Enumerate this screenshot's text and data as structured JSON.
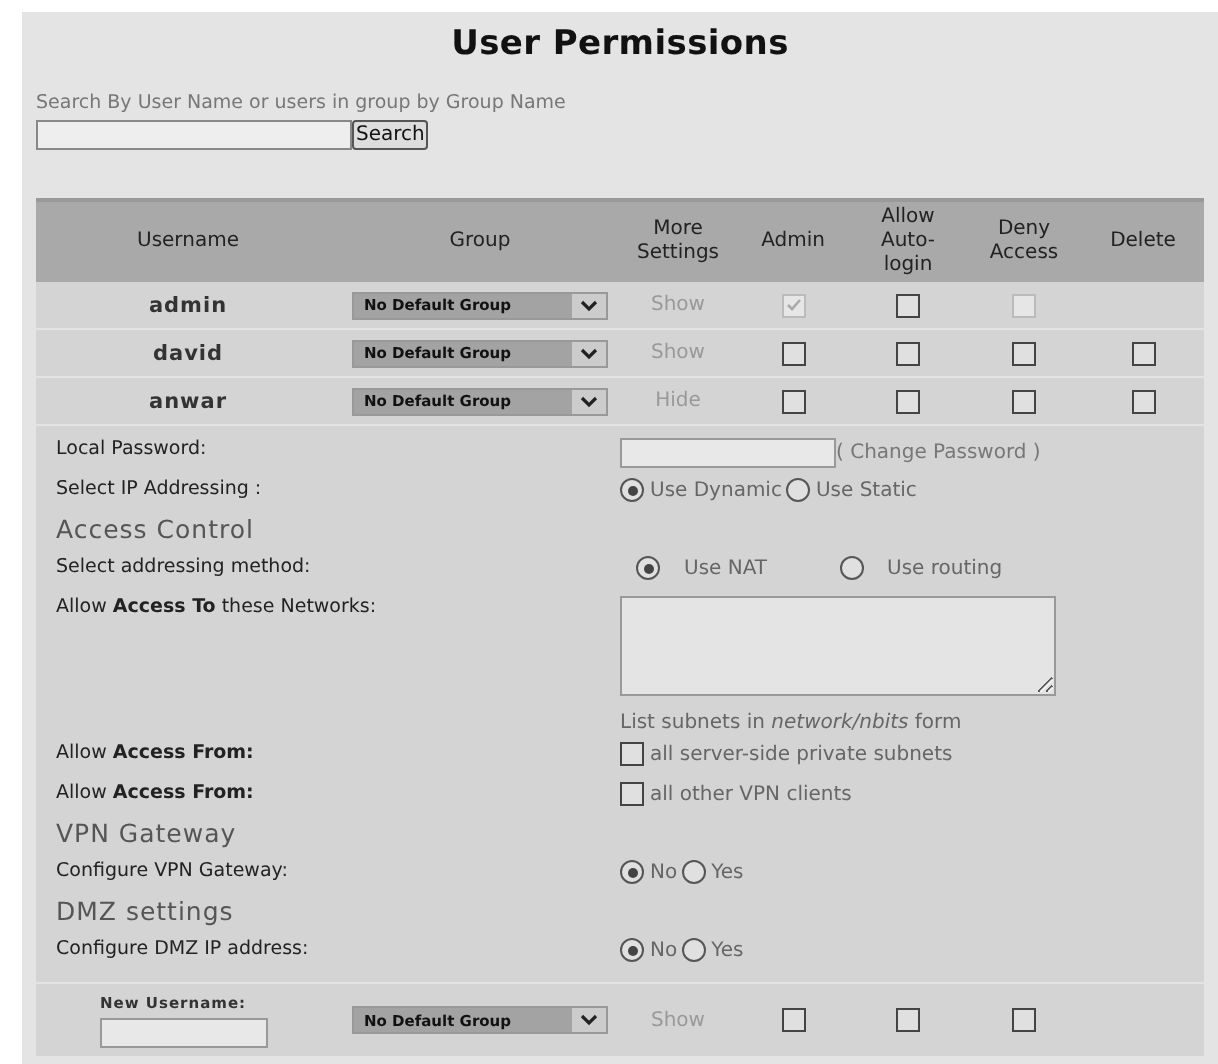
{
  "title": "User Permissions",
  "search": {
    "label": "Search By User Name or users in group by Group Name",
    "button": "Search"
  },
  "table": {
    "columns": [
      "Username",
      "Group",
      "More Settings",
      "Admin",
      "Allow Auto-login",
      "Deny Access",
      "Delete"
    ],
    "rows": [
      {
        "username": "admin",
        "group": "No Default Group",
        "more": "Show",
        "checks": [
          {
            "checked": true,
            "disabled": true
          },
          {
            "checked": false,
            "disabled": false
          },
          {
            "checked": false,
            "disabled": true
          }
        ]
      },
      {
        "username": "david",
        "group": "No Default Group",
        "more": "Show",
        "checks": [
          {
            "checked": false,
            "disabled": false
          },
          {
            "checked": false,
            "disabled": false
          },
          {
            "checked": false,
            "disabled": false
          },
          {
            "checked": false,
            "disabled": false
          }
        ]
      },
      {
        "username": "anwar",
        "group": "No Default Group",
        "more": "Hide",
        "checks": [
          {
            "checked": false,
            "disabled": false
          },
          {
            "checked": false,
            "disabled": false
          },
          {
            "checked": false,
            "disabled": false
          },
          {
            "checked": false,
            "disabled": false
          }
        ]
      }
    ],
    "details": [
      {
        "kind": "password",
        "label": "Local Password:",
        "link": "( Change Password )"
      },
      {
        "kind": "radio",
        "label": "Select IP Addressing :",
        "options": [
          {
            "label": "Use Dynamic",
            "selected": true
          },
          {
            "label": "Use Static",
            "selected": false
          }
        ]
      },
      {
        "kind": "heading",
        "label": "Access Control"
      },
      {
        "kind": "radio_wide",
        "label": "Select addressing method:",
        "options": [
          {
            "label": "Use NAT",
            "selected": true
          },
          {
            "label": "Use routing",
            "selected": false
          }
        ]
      },
      {
        "kind": "textarea",
        "label": "Allow **Access To** these Networks:",
        "note": "List subnets in *network/nbits* form"
      },
      {
        "kind": "checkbox",
        "label": "Allow **Access From:**",
        "option": "all server-side private subnets",
        "checked": false
      },
      {
        "kind": "checkbox",
        "label": "Allow **Access From:**",
        "option": "all other VPN clients",
        "checked": false
      },
      {
        "kind": "heading",
        "label": "VPN Gateway"
      },
      {
        "kind": "radio",
        "label": "Configure VPN Gateway:",
        "options": [
          {
            "label": "No",
            "selected": true
          },
          {
            "label": "Yes",
            "selected": false
          }
        ]
      },
      {
        "kind": "heading",
        "label": "DMZ settings"
      },
      {
        "kind": "radio",
        "label": "Configure DMZ IP address:",
        "options": [
          {
            "label": "No",
            "selected": true
          },
          {
            "label": "Yes",
            "selected": false
          }
        ]
      }
    ],
    "new_user": {
      "label": "New Username:",
      "group": "No Default Group",
      "more": "Show",
      "checks": [
        {
          "checked": false,
          "disabled": false
        },
        {
          "checked": false,
          "disabled": false
        },
        {
          "checked": false,
          "disabled": false
        }
      ]
    }
  }
}
